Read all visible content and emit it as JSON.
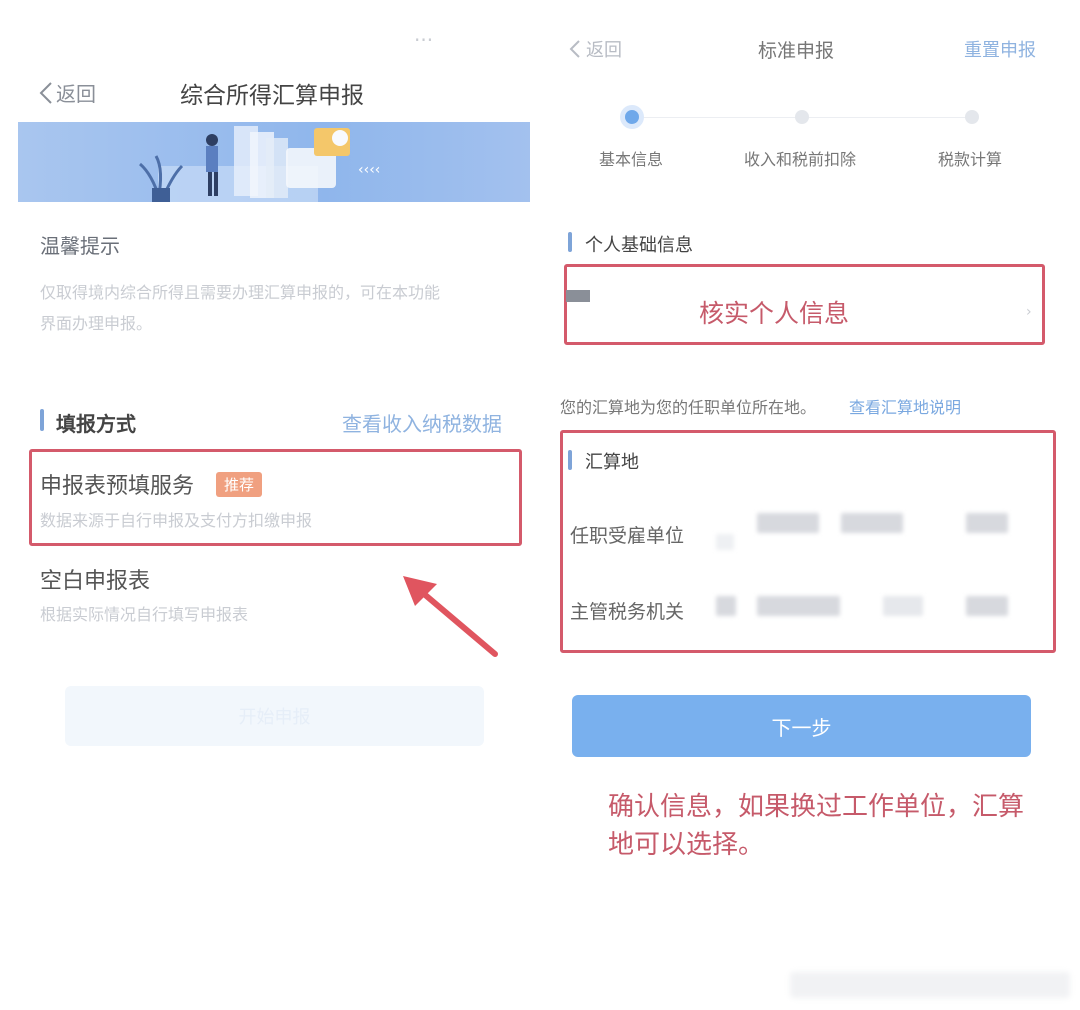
{
  "left": {
    "status_dots": "···",
    "back_label": "返回",
    "title": "综合所得汇算申报",
    "tip_title": "温馨提示",
    "tip_line1": "仅取得境内综合所得且需要办理汇算申报的，可在本功能",
    "tip_line2": "界面办理申报。",
    "method_title": "填报方式",
    "view_income_link": "查看收入纳税数据",
    "option1_title": "申报表预填服务",
    "option1_badge": "推荐",
    "option1_desc": "数据来源于自行申报及支付方扣缴申报",
    "option2_title": "空白申报表",
    "option2_desc": "根据实际情况自行填写申报表",
    "start_button": "开始申报"
  },
  "right": {
    "back_label": "返回",
    "title": "标准申报",
    "reset_label": "重置申报",
    "steps": [
      "基本信息",
      "收入和税前扣除",
      "税款计算"
    ],
    "personal_section": "个人基础信息",
    "verify_label": "核实个人信息",
    "settle_note": "您的汇算地为您的任职单位所在地。",
    "settle_link": "查看汇算地说明",
    "settle_section": "汇算地",
    "employer_label": "任职受雇单位",
    "tax_authority_label": "主管税务机关",
    "next_button": "下一步",
    "annotation_line1": "确认信息，如果换过工作单位，汇算",
    "annotation_line2": "地可以选择。"
  },
  "colors": {
    "highlight_red": "#d45a6b",
    "accent_blue": "#6fa8ea",
    "badge_orange": "#f0a080"
  }
}
